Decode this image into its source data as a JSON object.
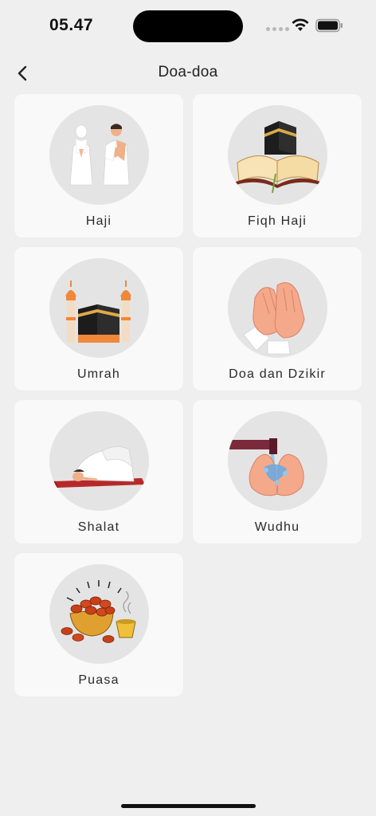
{
  "status": {
    "time": "05.47"
  },
  "header": {
    "title": "Doa-doa"
  },
  "categories": [
    {
      "label": "Haji",
      "icon": "pilgrims-praying-icon"
    },
    {
      "label": "Fiqh Haji",
      "icon": "kaaba-quran-icon"
    },
    {
      "label": "Umrah",
      "icon": "kaaba-minarets-icon"
    },
    {
      "label": "Doa dan Dzikir",
      "icon": "praying-hands-icon"
    },
    {
      "label": "Shalat",
      "icon": "prostrating-person-icon"
    },
    {
      "label": "Wudhu",
      "icon": "washing-hands-icon"
    },
    {
      "label": "Puasa",
      "icon": "dates-bowl-icon"
    }
  ]
}
